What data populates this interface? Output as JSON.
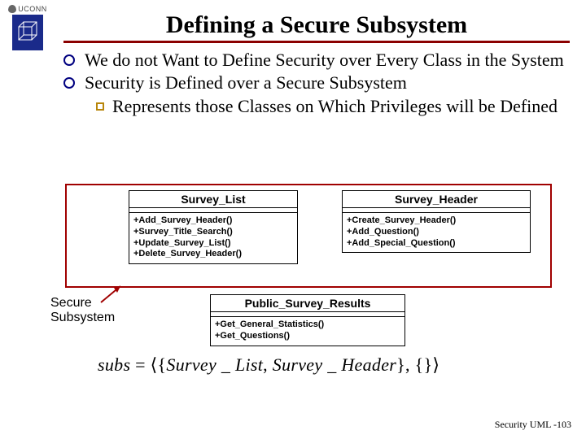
{
  "header": {
    "institution": "UCONN",
    "title": "Defining a Secure Subsystem"
  },
  "bullets": {
    "b1": "We do not Want to Define Security over Every Class in the System",
    "b2": "Security is Defined over a Secure Subsystem",
    "b2_sub1": "Represents those Classes on Which Privileges will be Defined"
  },
  "diagram": {
    "survey_list": {
      "name": "Survey_List",
      "ops": [
        "+Add_Survey_Header()",
        "+Survey_Title_Search()",
        "+Update_Survey_List()",
        "+Delete_Survey_Header()"
      ]
    },
    "survey_header": {
      "name": "Survey_Header",
      "ops": [
        "+Create_Survey_Header()",
        "+Add_Question()",
        "+Add_Special_Question()"
      ]
    },
    "public_results": {
      "name": "Public_Survey_Results",
      "ops": [
        "+Get_General_Statistics()",
        "+Get_Questions()"
      ]
    },
    "callout_line1": "Secure",
    "callout_line2": "Subsystem"
  },
  "formula": {
    "lhs": "subs",
    "eq": " = ",
    "open": "⟨{",
    "item1": "Survey _ List",
    "sep1": ", ",
    "item2": "Survey _ Header",
    "close_set": "},",
    "empty": " {}",
    "close": "⟩"
  },
  "footer": {
    "text": "Security UML -103"
  }
}
